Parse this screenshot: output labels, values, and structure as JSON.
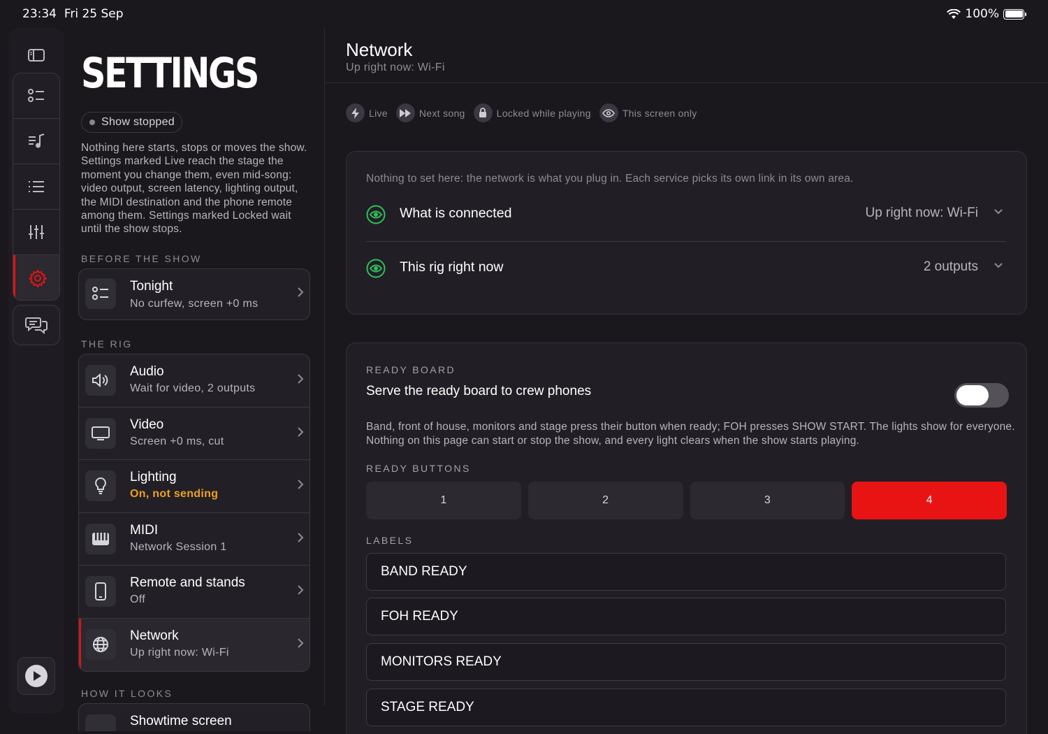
{
  "status_bar": {
    "time": "23:34",
    "date": "Fri 25 Sep",
    "battery": "100%"
  },
  "rail": {
    "items": [
      {
        "icon": "sidebar-toggle-icon"
      },
      {
        "icon": "checklist-icon"
      },
      {
        "icon": "music-list-icon"
      },
      {
        "icon": "list-icon"
      },
      {
        "icon": "sliders-icon"
      },
      {
        "icon": "gear-icon",
        "active": true
      },
      {
        "icon": "chat-icon"
      },
      {
        "icon": "play-icon"
      }
    ],
    "accent": "#e01414"
  },
  "sidebar": {
    "title": "SETTINGS",
    "status_pill": "Show stopped",
    "intro": "Nothing here starts, stops or moves the show. Settings marked Live reach the stage the moment you change them, even mid-song: video output, screen latency, lighting output, the MIDI destination and the phone remote among them. Settings marked Locked wait until the show stops.",
    "sections": [
      {
        "label": "BEFORE THE SHOW",
        "items": [
          {
            "title": "Tonight",
            "subtitle": "No curfew, screen +0 ms",
            "icon": "checklist-icon"
          }
        ]
      },
      {
        "label": "THE RIG",
        "items": [
          {
            "title": "Audio",
            "subtitle": "Wait for video, 2 outputs",
            "icon": "speaker-icon"
          },
          {
            "title": "Video",
            "subtitle": "Screen +0 ms, cut",
            "icon": "monitor-icon"
          },
          {
            "title": "Lighting",
            "subtitle": "On, not sending",
            "icon": "lightbulb-icon",
            "warn": true
          },
          {
            "title": "MIDI",
            "subtitle": "Network Session 1",
            "icon": "piano-icon"
          },
          {
            "title": "Remote and stands",
            "subtitle": "Off",
            "icon": "phone-icon"
          },
          {
            "title": "Network",
            "subtitle": "Up right now: Wi-Fi",
            "icon": "globe-icon",
            "selected": true
          }
        ]
      },
      {
        "label": "HOW IT LOOKS",
        "items": [
          {
            "title": "Showtime screen",
            "subtitle": "",
            "icon": "screen-icon"
          }
        ]
      }
    ]
  },
  "main": {
    "title": "Network",
    "subtitle": "Up right now: Wi-Fi",
    "legend": [
      {
        "label": "Live",
        "icon": "bolt-icon"
      },
      {
        "label": "Next song",
        "icon": "forward-icon"
      },
      {
        "label": "Locked while playing",
        "icon": "lock-icon"
      },
      {
        "label": "This screen only",
        "icon": "eye-icon"
      }
    ],
    "network_panel": {
      "note": "Nothing to set here: the network is what you plug in. Each service picks its own link in its own area.",
      "rows": [
        {
          "label": "What is connected",
          "value": "Up right now: Wi-Fi"
        },
        {
          "label": "This rig right now",
          "value": "2 outputs"
        }
      ]
    },
    "ready_board": {
      "caption": "READY BOARD",
      "toggle_label": "Serve the ready board to crew phones",
      "toggle_on": false,
      "description": "Band, front of house, monitors and stage press their button when ready; FOH presses SHOW START. The lights show for everyone. Nothing on this page can start or stop the show, and every light clears when the show starts playing.",
      "buttons_caption": "READY BUTTONS",
      "buttons": [
        "1",
        "2",
        "3",
        "4"
      ],
      "selected_button": "4",
      "labels_caption": "LABELS",
      "labels": [
        "BAND READY",
        "FOH READY",
        "MONITORS READY",
        "STAGE READY"
      ]
    },
    "eye_color": "#2fbf5a",
    "accent": "#e81414"
  }
}
